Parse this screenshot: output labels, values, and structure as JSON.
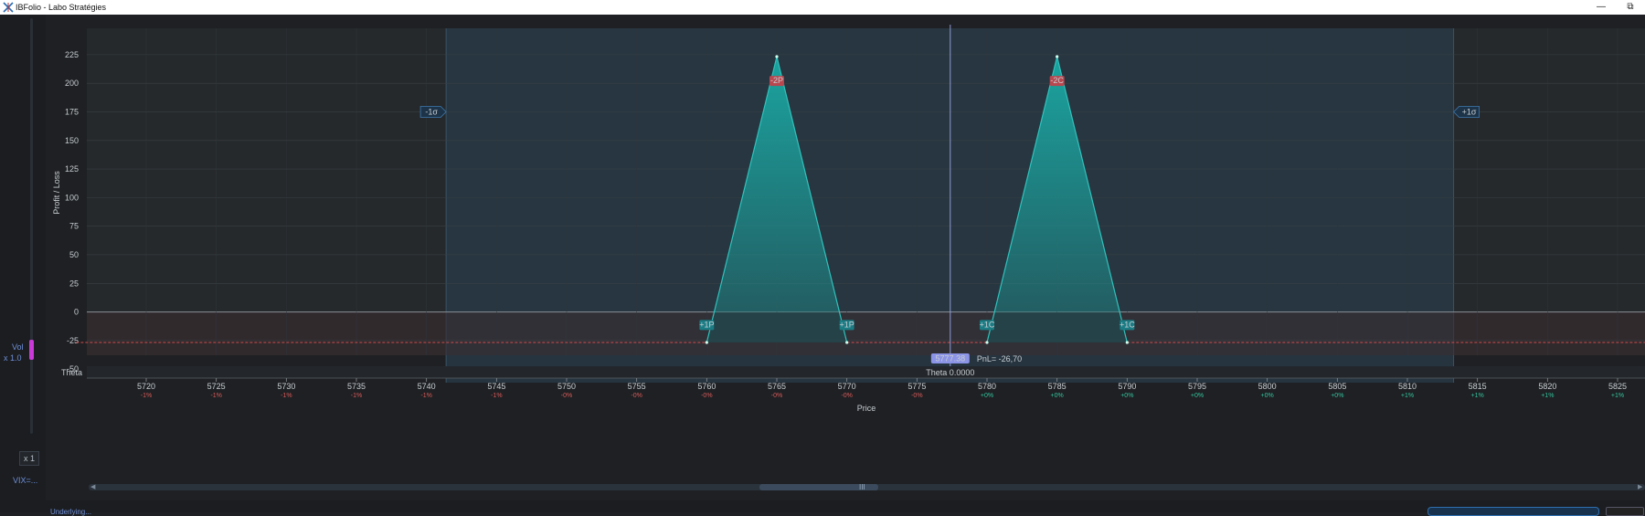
{
  "window": {
    "title": "IBFolio - Labo Stratégies",
    "app_icon": "ib-logo-icon",
    "buttons": [
      "minimize-icon",
      "restore-icon"
    ]
  },
  "left_panel": {
    "vol_label": "Vol",
    "vol_multiplier": "x 1.0",
    "zoom_button": "x 1",
    "vix_label": "VIX=..."
  },
  "chart_data": {
    "type": "line",
    "xlabel": "Price",
    "ylabel": "Profit / Loss",
    "xlim": [
      5715,
      5827.5
    ],
    "ylim": [
      -55,
      245
    ],
    "x_ticks": [
      5720,
      5725,
      5730,
      5735,
      5740,
      5745,
      5750,
      5755,
      5760,
      5765,
      5770,
      5775,
      5780,
      5785,
      5790,
      5795,
      5800,
      5805,
      5810,
      5815,
      5820,
      5825
    ],
    "x_pct_labels": [
      "-1%",
      "-1%",
      "-1%",
      "-1%",
      "-1%",
      "-1%",
      "-0%",
      "-0%",
      "-0%",
      "-0%",
      "-0%",
      "-0%",
      "+0%",
      "+0%",
      "+0%",
      "+0%",
      "+0%",
      "+0%",
      "+1%",
      "+1%",
      "+1%",
      "+1%"
    ],
    "y_ticks": [
      225,
      200,
      175,
      150,
      125,
      100,
      75,
      50,
      25,
      0,
      -25,
      -50
    ],
    "series": [
      {
        "x": [
          5715,
          5760,
          5765,
          5770,
          5780,
          5785,
          5790,
          5827.5
        ],
        "y": [
          -26.7,
          -26.7,
          223.3,
          -26.7,
          -26.7,
          223.3,
          -26.7,
          -26.7
        ]
      }
    ],
    "legs": [
      {
        "label": "+1P",
        "x": 5760
      },
      {
        "label": "-2P",
        "x": 5765
      },
      {
        "label": "+1P",
        "x": 5770
      },
      {
        "label": "+1C",
        "x": 5780
      },
      {
        "label": "-2C",
        "x": 5785
      },
      {
        "label": "+1C",
        "x": 5790
      }
    ],
    "sigma_band": {
      "low": 5741.4,
      "high": 5813.3,
      "low_label": "-1σ",
      "high_label": "+1σ"
    },
    "current_price": 5777.38,
    "current_price_label": "5777.38",
    "pnl_label": "PnL= -26,70",
    "theta_label": "Theta",
    "theta_value_label": "Theta 0.0000",
    "grid": true,
    "colors": {
      "area": "#1aa9a4",
      "loss_line": "#d24c4c",
      "short_tag": "#b8474f",
      "long_tag": "#1b7c84",
      "price_line": "#9aa6e8",
      "positive_pct": "#35c49f",
      "negative_pct": "#d85a5a"
    }
  },
  "status_bar": {
    "left_text": "Underlying..."
  },
  "scrollbar": {
    "grip": "III"
  }
}
